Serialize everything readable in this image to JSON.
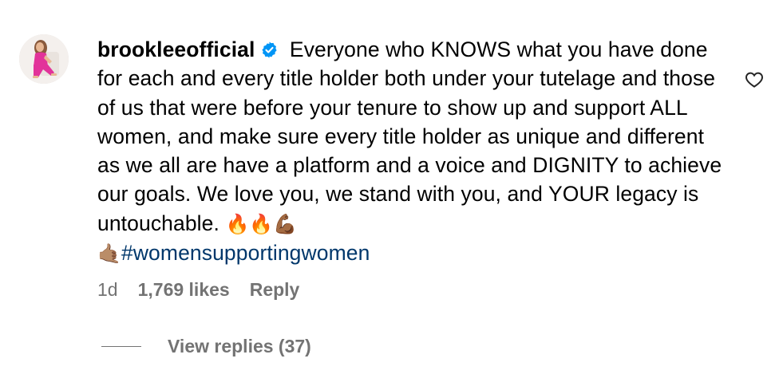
{
  "comment": {
    "username": "brookleeofficial",
    "verified_icon": "verified-badge-icon",
    "text": "Everyone who KNOWS what you have done for each and every title holder both under your tutelage and those of us that were before your tenure to show up and support ALL women, and make sure every title holder as unique and different as we all are have a platform and a voice and DIGNITY to achieve our goals. We love you, we stand with you, and YOUR legacy is untouchable.",
    "emojis_end": "🔥🔥💪🏾",
    "emoji_shaka": "🤙🏽",
    "hashtag": "#womensupportingwomen",
    "time_ago": "1d",
    "likes": "1,769 likes",
    "reply_label": "Reply",
    "view_replies": "View replies (37)"
  },
  "colors": {
    "hashtag": "#00376b",
    "meta": "#737373",
    "verified": "#0095f6"
  }
}
